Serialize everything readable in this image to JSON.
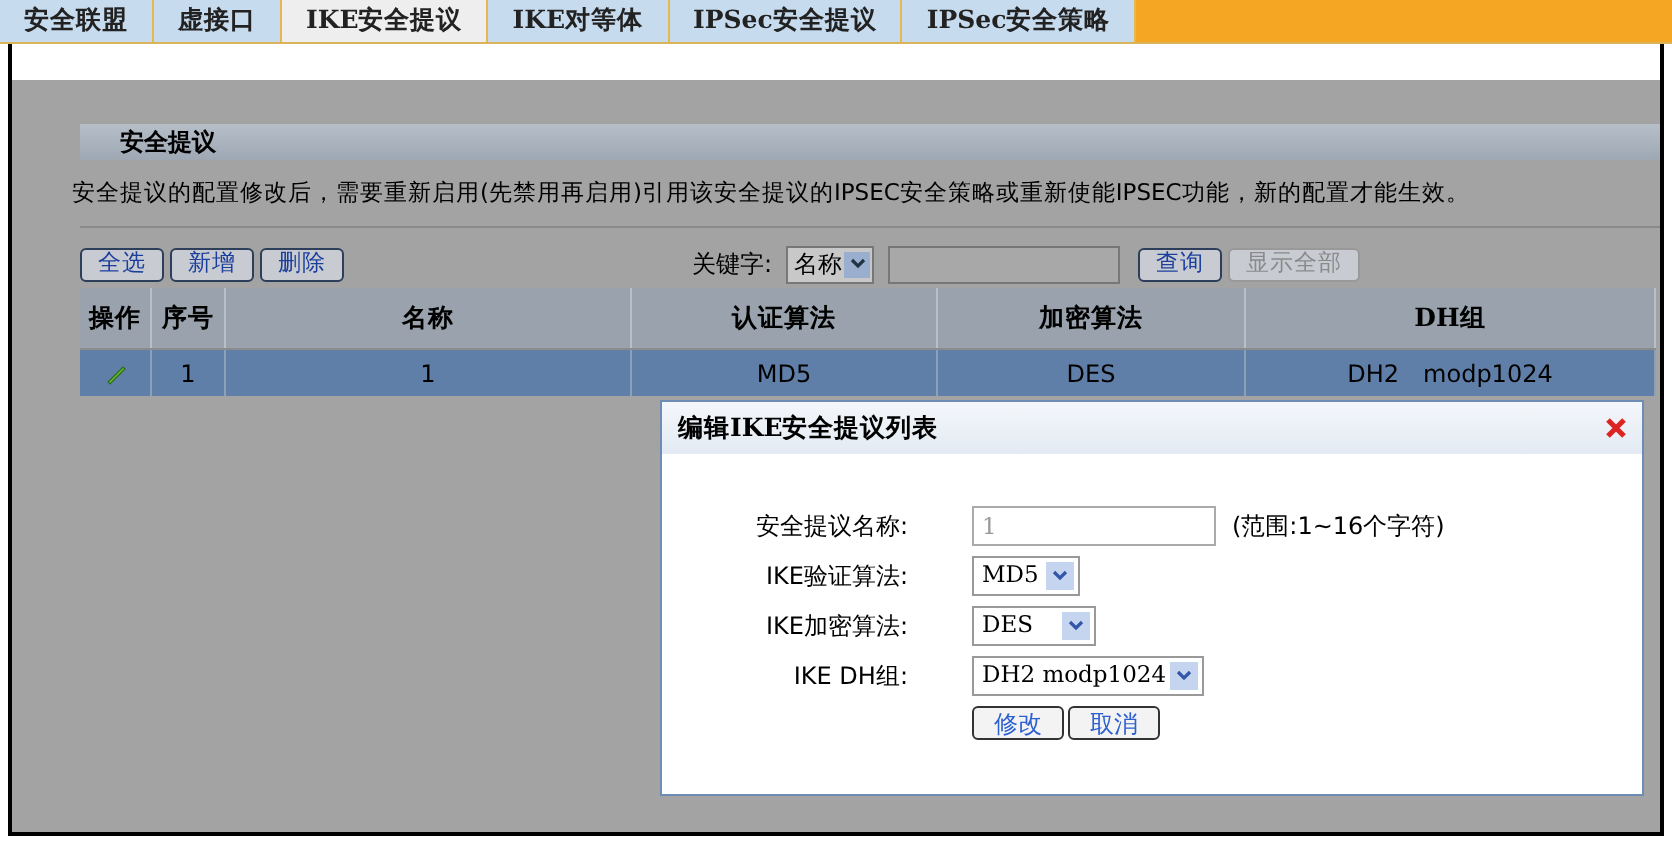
{
  "tabs": [
    {
      "label": "安全联盟",
      "selected": false
    },
    {
      "label": "虚接口",
      "selected": false
    },
    {
      "label": "IKE安全提议",
      "selected": true
    },
    {
      "label": "IKE对等体",
      "selected": false
    },
    {
      "label": "IPSec安全提议",
      "selected": false
    },
    {
      "label": "IPSec安全策略",
      "selected": false
    }
  ],
  "panel": {
    "title": "安全提议",
    "notice": "安全提议的配置修改后，需要重新启用(先禁用再启用)引用该安全提议的IPSEC安全策略或重新使能IPSEC功能，新的配置才能生效。"
  },
  "toolbar": {
    "buttons": [
      {
        "label": "全选",
        "disabled": false
      },
      {
        "label": "新增",
        "disabled": false
      },
      {
        "label": "删除",
        "disabled": false
      }
    ],
    "search": {
      "label": "关键字:",
      "field": "名称",
      "query_button": {
        "label": "查询",
        "disabled": false
      },
      "show_all_button": {
        "label": "显示全部",
        "disabled": true
      }
    }
  },
  "table": {
    "columns": [
      "操作",
      "序号",
      "名称",
      "认证算法",
      "加密算法",
      "DH组"
    ],
    "rows": [
      {
        "selected": true,
        "cells": [
          "",
          "1",
          "1",
          "MD5",
          "DES",
          "DH2　modp1024"
        ]
      }
    ]
  },
  "dialog": {
    "title": "编辑IKE安全提议列表",
    "fields": [
      {
        "kind": "text",
        "label": "安全提议名称:",
        "value": "1",
        "hint": "(范围:1~16个字符)",
        "disabled": true
      },
      {
        "kind": "select",
        "label": "IKE验证算法:",
        "value": "MD5"
      },
      {
        "kind": "select",
        "label": "IKE加密算法:",
        "value": "DES"
      },
      {
        "kind": "select",
        "label": "IKE DH组:",
        "value": "DH2 modp1024"
      }
    ],
    "buttons": [
      "修改",
      "取消"
    ]
  }
}
